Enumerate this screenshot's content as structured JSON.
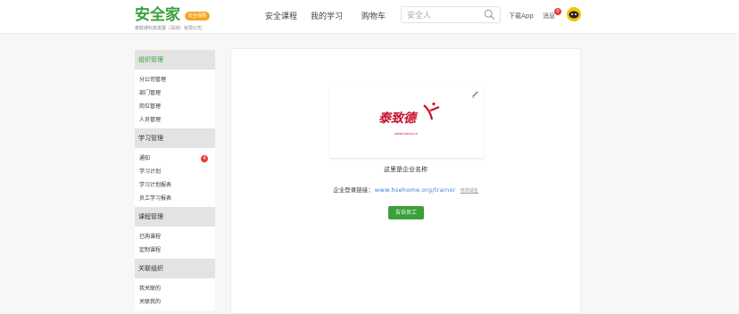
{
  "header": {
    "logo_text": "安全家",
    "logo_badge": "安全保障",
    "logo_subtitle": "泰致德科技发展（深圳）有限公司",
    "nav": [
      "安全课程",
      "我的学习",
      "购物车"
    ],
    "search_placeholder": "安全人",
    "download_app": "下载App",
    "messages": "消息",
    "message_count": "0"
  },
  "sidebar": {
    "sections": [
      {
        "title": "组织管理",
        "items": [
          "分公司管理",
          "部门管理",
          "岗位管理",
          "人员管理"
        ]
      },
      {
        "title": "学习管理",
        "items": [
          "通知",
          "学习计划",
          "学习计划报表",
          "员工学习报表"
        ],
        "notice_count": "4"
      },
      {
        "title": "课程管理",
        "items": [
          "已购课程",
          "定制课程"
        ]
      },
      {
        "title": "关联组织",
        "items": [
          "我关联的",
          "关联我的"
        ]
      }
    ]
  },
  "main": {
    "brand_name": "泰致德",
    "brand_url": "www.trainor.cn",
    "company_name": "这里是企业名称",
    "login_link_label": "企业登录链接：",
    "login_link_url": "www.hsehome.org/trainor",
    "modify_domain": "修改域名",
    "invite_button": "告诉员工"
  },
  "colors": {
    "brand_green": "#3aa03a",
    "badge_red": "#e53935",
    "logo_red": "#c8102e"
  }
}
